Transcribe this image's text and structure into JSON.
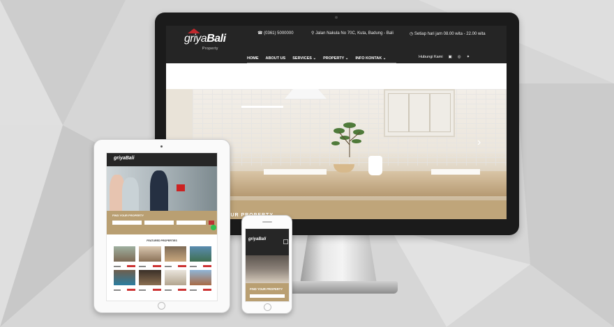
{
  "colors": {
    "background": "#d8d8d8",
    "header_dark": "#252525",
    "accent_tan": "#bfa57a",
    "logo_red": "#c0282d",
    "whatsapp_green": "#2fbf50"
  },
  "desktop": {
    "logo": {
      "brand": "griya",
      "brand_bold": "Bali",
      "sub": "Property"
    },
    "contact": {
      "phone_icon": "phone-icon",
      "phone": "(0361) 5000000",
      "address_icon": "map-pin-icon",
      "address": "Jalan Nakula No 70C, Kuta, Badung - Bali",
      "hours_icon": "clock-icon",
      "hours": "Setiap hari jam 08.00 wita - 22.00 wita"
    },
    "nav": [
      {
        "label": "HOME"
      },
      {
        "label": "ABOUT US"
      },
      {
        "label": "SERVICES",
        "dropdown": true
      },
      {
        "label": "PROPERTY",
        "dropdown": true
      },
      {
        "label": "INFO KONTAK",
        "dropdown": true
      }
    ],
    "right": {
      "contact_label": "Hubungi Kami",
      "social_icons": [
        "youtube-icon",
        "instagram-icon",
        "twitter-icon"
      ]
    },
    "hero_arrow": "chevron-right-icon",
    "banner_text": "OUR PROPERTY"
  },
  "tablet": {
    "find_label": "FIND YOUR PROPERTY",
    "featured_label": "FEATURED PROPERTIES"
  },
  "phone": {
    "find_label": "FIND YOUR PROPERTY"
  }
}
